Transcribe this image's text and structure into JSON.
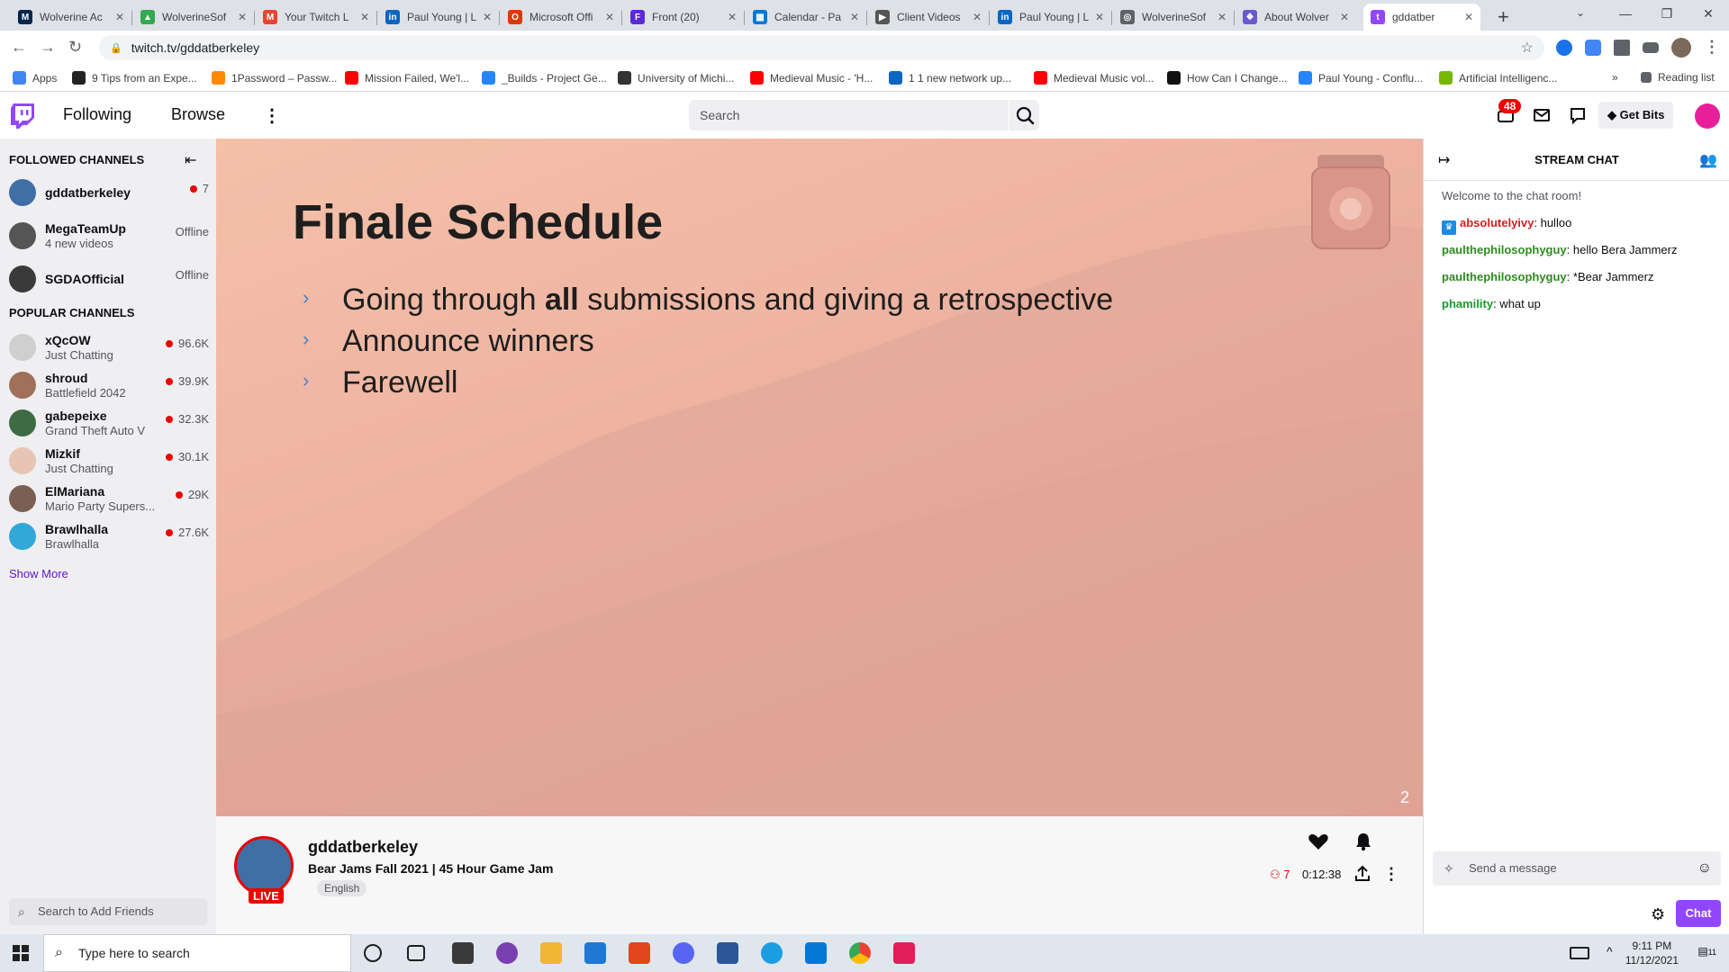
{
  "browser": {
    "tabs": [
      {
        "title": "Wolverine Ac",
        "color": "#00274c",
        "glyph": "M"
      },
      {
        "title": "WolverineSof",
        "color": "#34a853",
        "glyph": "▲"
      },
      {
        "title": "Your Twitch L",
        "color": "#ea4335",
        "glyph": "M"
      },
      {
        "title": "Paul Young | L",
        "color": "#0a66c2",
        "glyph": "in"
      },
      {
        "title": "Microsoft Offi",
        "color": "#d83b01",
        "glyph": "O"
      },
      {
        "title": "Front (20)",
        "color": "#5b2bd8",
        "glyph": "F"
      },
      {
        "title": "Calendar - Pa",
        "color": "#0078d4",
        "glyph": "▦"
      },
      {
        "title": "Client Videos",
        "color": "#555555",
        "glyph": "▶"
      },
      {
        "title": "Paul Young | L",
        "color": "#0a66c2",
        "glyph": "in"
      },
      {
        "title": "WolverineSof",
        "color": "#5f6368",
        "glyph": "◎"
      },
      {
        "title": "About Wolver",
        "color": "#6a5acd",
        "glyph": "❖"
      },
      {
        "title": "gddatber",
        "color": "#9147ff",
        "glyph": "t",
        "active": true
      }
    ],
    "url": "twitch.tv/gddatberkeley",
    "bookmarks": [
      {
        "label": "Apps",
        "color": "#4285f4"
      },
      {
        "label": "9 Tips from an Expe...",
        "color": "#222222"
      },
      {
        "label": "1Password – Passw...",
        "color": "#ff8a00"
      },
      {
        "label": "Mission Failed, We'l...",
        "color": "#ff0000"
      },
      {
        "label": "_Builds - Project Ge...",
        "color": "#2684ff"
      },
      {
        "label": "University of Michi...",
        "color": "#333333"
      },
      {
        "label": "Medieval Music - 'H...",
        "color": "#ff0000"
      },
      {
        "label": "1 1 new network up...",
        "color": "#0a66c2"
      },
      {
        "label": "Medieval Music vol...",
        "color": "#ff0000"
      },
      {
        "label": "How Can I Change...",
        "color": "#111111"
      },
      {
        "label": "Paul Young - Conflu...",
        "color": "#2684ff"
      },
      {
        "label": "Artificial Intelligenc...",
        "color": "#76b900"
      }
    ],
    "reading_list": "Reading list",
    "more_bookmarks": "»"
  },
  "nav": {
    "following": "Following",
    "browse": "Browse",
    "search_placeholder": "Search",
    "notif_count": "48",
    "get_bits": "Get Bits"
  },
  "sidebar": {
    "followed_title": "FOLLOWED CHANNELS",
    "followed": [
      {
        "name": "gddatberkeley",
        "sub": "",
        "status": "7",
        "live": true,
        "color": "#3f6fa4"
      },
      {
        "name": "MegaTeamUp",
        "sub": "4 new videos",
        "status": "Offline",
        "live": false,
        "color": "#555555"
      },
      {
        "name": "SGDAOfficial",
        "sub": "",
        "status": "Offline",
        "live": false,
        "color": "#3a3a3a"
      }
    ],
    "popular_title": "POPULAR CHANNELS",
    "popular": [
      {
        "name": "xQcOW",
        "sub": "Just Chatting",
        "status": "96.6K",
        "live": true,
        "color": "#cfcfcf"
      },
      {
        "name": "shroud",
        "sub": "Battlefield 2042",
        "status": "39.9K",
        "live": true,
        "color": "#a0705a"
      },
      {
        "name": "gabepeixe",
        "sub": "Grand Theft Auto V",
        "status": "32.3K",
        "live": true,
        "color": "#3e6b44"
      },
      {
        "name": "Mizkif",
        "sub": "Just Chatting",
        "status": "30.1K",
        "live": true,
        "color": "#e8c4b4"
      },
      {
        "name": "ElMariana",
        "sub": "Mario Party Supers...",
        "status": "29K",
        "live": true,
        "color": "#7a5f55"
      },
      {
        "name": "Brawlhalla",
        "sub": "Brawlhalla",
        "status": "27.6K",
        "live": true,
        "color": "#31a8d8"
      }
    ],
    "show_more": "Show More",
    "friend_search": "Search to Add Friends"
  },
  "slide": {
    "title": "Finale Schedule",
    "bullets": [
      {
        "pre": "Going through ",
        "bold": "all",
        "post": " submissions and giving a retrospective"
      },
      {
        "pre": "Announce winners",
        "bold": "",
        "post": ""
      },
      {
        "pre": "Farewell",
        "bold": "",
        "post": ""
      }
    ],
    "page": "2"
  },
  "stream": {
    "channel": "gddatberkeley",
    "live_label": "LIVE",
    "title": "Bear Jams Fall 2021 | 45 Hour Game Jam",
    "language": "English",
    "viewers": "7",
    "uptime": "0:12:38"
  },
  "chat": {
    "header": "STREAM CHAT",
    "welcome": "Welcome to the chat room!",
    "messages": [
      {
        "user": "absolutelyivy",
        "text": ": hulloo",
        "color": "#d11f1f",
        "badge": true
      },
      {
        "user": "paulthephilosophyguy",
        "text": ": hello Bera Jammerz",
        "color": "#2e8b1f",
        "badge": false
      },
      {
        "user": "paulthephilosophyguy",
        "text": ": *Bear Jammerz",
        "color": "#2e8b1f",
        "badge": false
      },
      {
        "user": "phamility",
        "text": ": what up",
        "color": "#1a9a2a",
        "badge": false
      }
    ],
    "input_placeholder": "Send a message",
    "send_label": "Chat"
  },
  "taskbar": {
    "search_placeholder": "Type here to search",
    "time": "9:11 PM",
    "date": "11/12/2021",
    "notif_count": "11"
  },
  "colors": {
    "twitch_purple": "#9147ff",
    "live_red": "#eb0400"
  }
}
